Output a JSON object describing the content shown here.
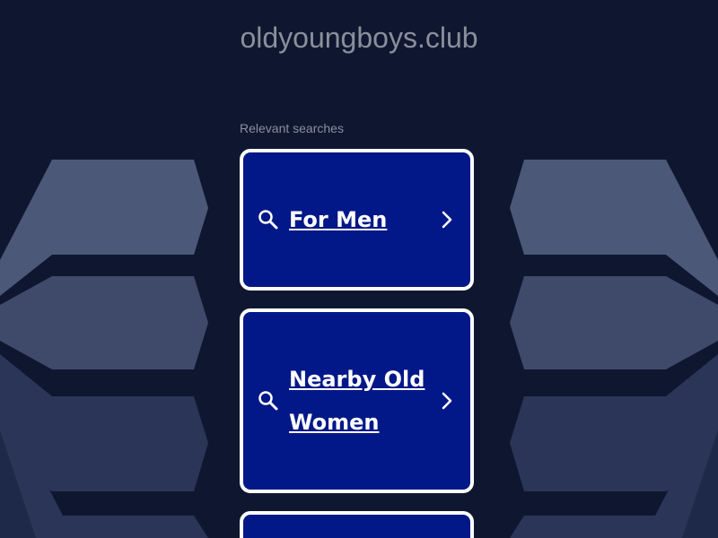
{
  "header": {
    "domain": "oldyoungboys.club"
  },
  "searches": {
    "heading": "Relevant searches",
    "items": [
      {
        "label": "For Men"
      },
      {
        "label": "Nearby Old Women"
      },
      {
        "label": ""
      }
    ]
  },
  "colors": {
    "background": "#0f1730",
    "card": "#031888",
    "card_border": "#ffffff",
    "muted_text": "#8a8f9c"
  }
}
